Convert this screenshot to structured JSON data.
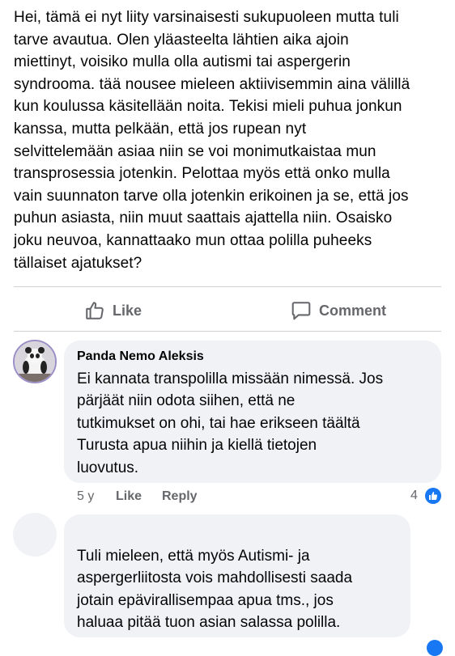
{
  "post": {
    "text": "Hei, tämä ei nyt liity varsinaisesti sukupuoleen mutta tuli\ntarve avautua. Olen yläasteelta lähtien aika ajoin\nmiettinyt, voisiko mulla olla autismi tai aspergerin\nsyndrooma. tää nousee mieleen aktiivisemmin aina välillä\nkun koulussa käsitellään noita. Tekisi mieli puhua jonkun\nkanssa, mutta pelkään, että jos rupean nyt\nselvittelemään asiaa niin se voi monimutkaistaa mun\ntransprosessia jotenkin. Pelottaa myös että onko mulla\nvain suunnaton tarve olla jotenkin erikoinen ja se, että jos\npuhun asiasta, niin muut saattais ajattella niin. Osaisko\njoku neuvoa, kannattaako mun ottaa polilla puheeks\ntällaiset ajatukset?"
  },
  "actions": {
    "like_label": "Like",
    "comment_label": "Comment",
    "like_icon": "thumbs-up-outline-icon",
    "comment_icon": "speech-bubble-outline-icon"
  },
  "comments": [
    {
      "author": "Panda Nemo Aleksis",
      "text": "Ei kannata transpolilla missään nimessä. Jos\npärjäät niin odota siihen, että ne\ntutkimukset on ohi, tai hae erikseen täältä\nTurusta apua niihin ja kiellä tietojen\nluovutus.",
      "time": "5 y",
      "like_label": "Like",
      "reply_label": "Reply",
      "reaction_count": "4"
    },
    {
      "author": "",
      "text": "Tuli mieleen, että myös Autismi- ja\naspergerliitosta vois mahdollisesti saada\njotain epävirallisempaa apua tms., jos\nhaluaa pitää tuon asian salassa polilla."
    }
  ],
  "colors": {
    "text": "#050505",
    "secondary": "#65676b",
    "bubble": "#f0f2f5",
    "divider": "#ced0d4",
    "accent": "#1877f2"
  }
}
